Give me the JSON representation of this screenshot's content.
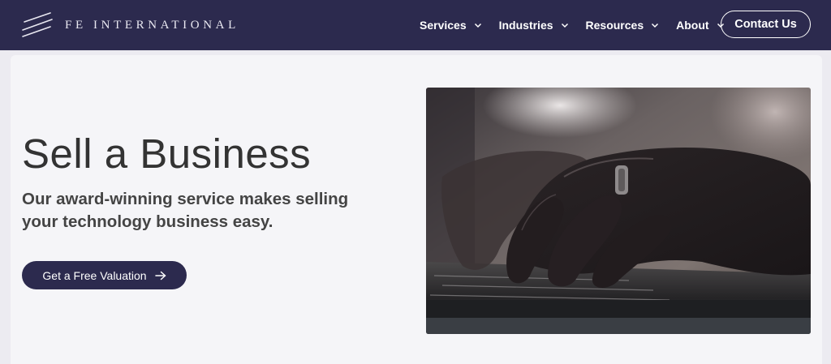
{
  "brand": {
    "name": "FE INTERNATIONAL",
    "logo_icon": "diagonal-lines-logo"
  },
  "nav": {
    "items": [
      {
        "label": "Services",
        "icon": "chevron-down-icon"
      },
      {
        "label": "Industries",
        "icon": "chevron-down-icon"
      },
      {
        "label": "Resources",
        "icon": "chevron-down-icon"
      },
      {
        "label": "About",
        "icon": "chevron-down-icon"
      }
    ],
    "contact_label": "Contact Us"
  },
  "hero": {
    "title": "Sell a Business",
    "subtitle": "Our award-winning service makes selling your technology business easy.",
    "cta_label": "Get a Free Valuation",
    "cta_icon": "arrow-right-icon",
    "image_subject": "hands typing on a laptop keyboard"
  },
  "colors": {
    "nav_background": "#2c2a4e",
    "hero_background": "#f5f5f8",
    "page_background": "#ecebf1",
    "cta_background": "#2c2a4e",
    "text_dark": "#333333"
  }
}
